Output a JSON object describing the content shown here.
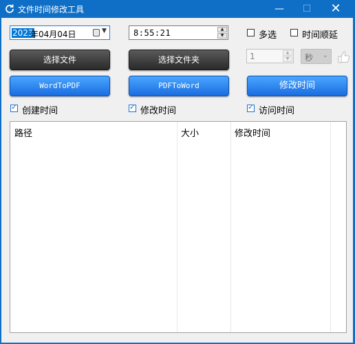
{
  "window": {
    "title": "文件时间修改工具",
    "controls": {
      "minimize": "—",
      "maximize": "☐",
      "close": "✕"
    },
    "accent": "#0f6fc6"
  },
  "date_picker": {
    "year": "2023",
    "rest": "年04月04日"
  },
  "time_picker": {
    "value": "8:55:21"
  },
  "options": {
    "multi_select": "多选",
    "time_order": "时间顺延"
  },
  "buttons": {
    "select_file": "选择文件",
    "select_folder": "选择文件夹",
    "word_to_pdf": "WordToPDF",
    "pdf_to_word": "PDFToWord",
    "modify_time": "修改时间"
  },
  "offset": {
    "value": "1",
    "unit": "秒"
  },
  "checkboxes": {
    "created": {
      "label": "创建时间",
      "checked": true
    },
    "modified": {
      "label": "修改时间",
      "checked": true
    },
    "accessed": {
      "label": "访问时间",
      "checked": true
    }
  },
  "file_list": {
    "columns": [
      "路径",
      "大小",
      "修改时间"
    ],
    "rows": []
  },
  "icons": {
    "app": "refresh-icon",
    "thumb": "thumbs-up-icon",
    "calendar": "calendar-icon"
  }
}
